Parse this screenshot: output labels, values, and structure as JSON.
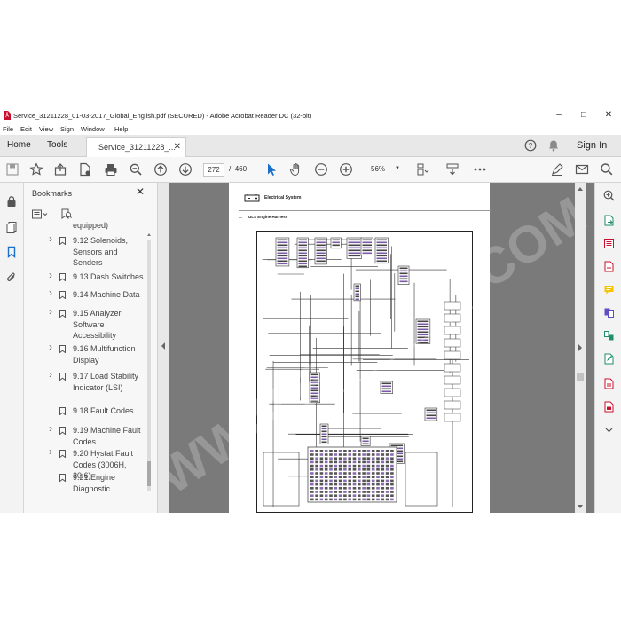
{
  "window": {
    "title": "Service_31211228_01-03-2017_Global_English.pdf (SECURED) - Adobe Acrobat Reader DC (32-bit)",
    "controls": {
      "minimize": "–",
      "maximize": "□",
      "close": "✕"
    }
  },
  "menu": [
    "File",
    "Edit",
    "View",
    "Sign",
    "Window",
    "Help"
  ],
  "tabs": {
    "home": "Home",
    "tools": "Tools",
    "document": "Service_31211228_...",
    "close": "✕",
    "sign_in": "Sign In"
  },
  "toolbar": {
    "page_current": "272",
    "page_separator": "/",
    "page_total": "460",
    "zoom": "56%"
  },
  "bookmarks": {
    "title": "Bookmarks",
    "close": "✕",
    "items": [
      {
        "label": "equipped)",
        "expandable": false,
        "flag": false
      },
      {
        "label": "9.12 Solenoids, Sensors and Senders",
        "expandable": true,
        "flag": true
      },
      {
        "label": "9.13 Dash Switches",
        "expandable": true,
        "flag": true
      },
      {
        "label": "9.14 Machine Data",
        "expandable": true,
        "flag": true
      },
      {
        "label": "9.15 Analyzer Software Accessibility",
        "expandable": true,
        "flag": true
      },
      {
        "label": "9.16 Multifunction Display",
        "expandable": true,
        "flag": true
      },
      {
        "label": "9.17 Load Stability Indicator (LSI)",
        "expandable": true,
        "flag": true
      },
      {
        "label": "9.18 Fault Codes",
        "expandable": false,
        "flag": true
      },
      {
        "label": "9.19 Machine Fault Codes",
        "expandable": true,
        "flag": true
      },
      {
        "label": "9.20 Hystat Fault Codes (3006H, 30.6)",
        "expandable": true,
        "flag": true
      },
      {
        "label": "9.21 Engine Diagnostic",
        "expandable": false,
        "flag": true
      }
    ]
  },
  "document": {
    "section": "Electrical System",
    "caption": "ULS Engine Harness",
    "figure_number": "1."
  },
  "watermark": "WWW.E______.COM",
  "colors": {
    "accent_blue": "#1a6fc9",
    "icon_gray": "#555555",
    "panel_bg": "#f7f7f7",
    "viewport_bg": "#7a7a7a",
    "acrobat_red": "#c8102e"
  }
}
